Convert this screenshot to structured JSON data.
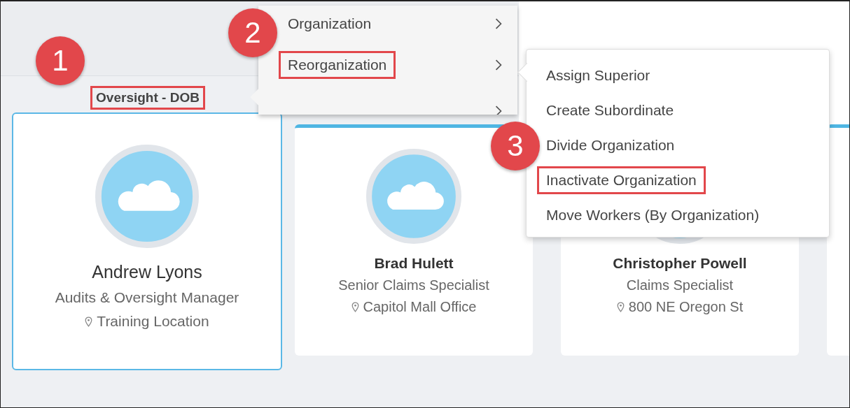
{
  "org_label": {
    "text": "Oversight - DOB",
    "highlighted": true
  },
  "menu": {
    "items": [
      {
        "label": "Organization",
        "highlighted": false
      },
      {
        "label": "Reorganization",
        "highlighted": true
      }
    ]
  },
  "submenu": {
    "items": [
      {
        "label": "Assign Superior",
        "highlighted": false
      },
      {
        "label": "Create Subordinate",
        "highlighted": false
      },
      {
        "label": "Divide Organization",
        "highlighted": false
      },
      {
        "label": "Inactivate Organization",
        "highlighted": true
      },
      {
        "label": "Move Workers (By Organization)",
        "highlighted": false
      }
    ]
  },
  "cards": [
    {
      "name": "Andrew Lyons",
      "title": "Audits & Oversight Manager",
      "location": "Training Location",
      "selected": true
    },
    {
      "name": "Brad Hulett",
      "title": "Senior Claims Specialist",
      "location": "Capitol Mall Office",
      "selected": false
    },
    {
      "name": "Christopher Powell",
      "title": "Claims Specialist",
      "location": "800 NE Oregon St",
      "selected": false
    }
  ],
  "callouts": [
    "1",
    "2",
    "3"
  ]
}
